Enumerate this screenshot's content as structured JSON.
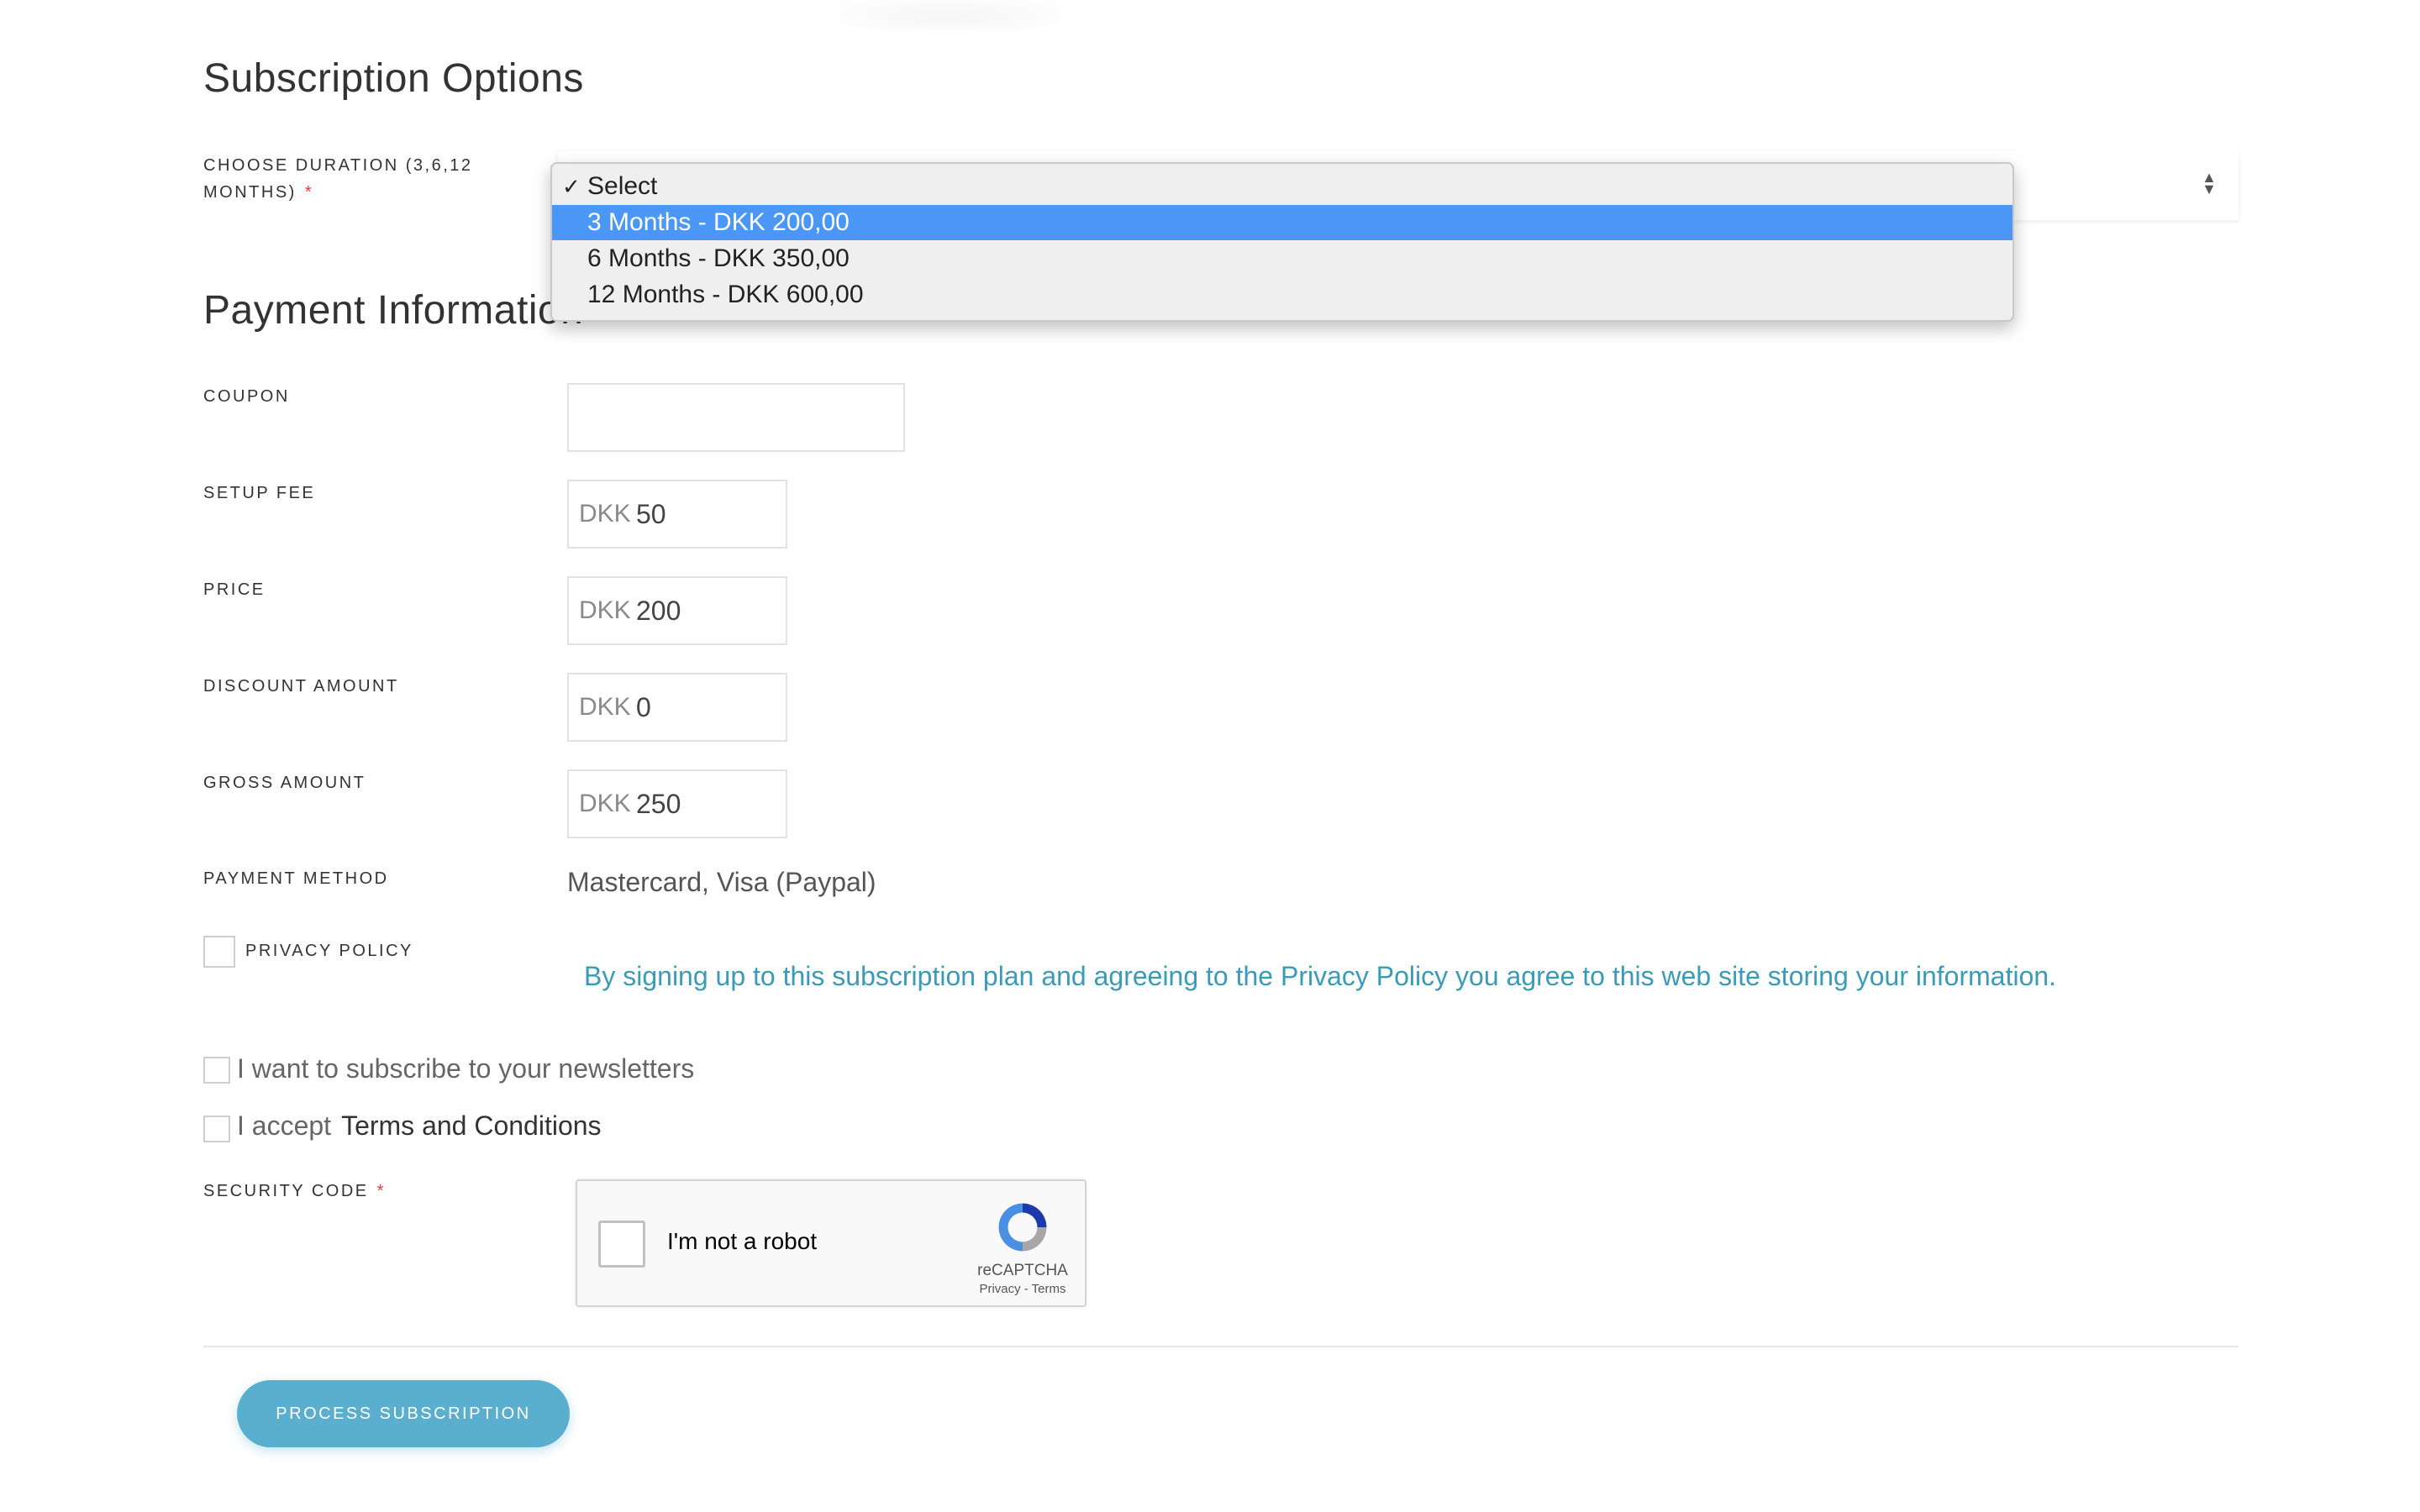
{
  "subscription": {
    "title": "Subscription Options",
    "duration_label": "CHOOSE DURATION (3,6,12 MONTHS)",
    "required_mark": "*",
    "select": {
      "current": "Select",
      "check_glyph": "✓",
      "options": [
        "Select",
        "3 Months - DKK 200,00",
        "6 Months - DKK 350,00",
        "12 Months - DKK 600,00"
      ],
      "highlighted_index": 1
    }
  },
  "payment": {
    "title": "Payment Information",
    "coupon_label": "COUPON",
    "coupon_value": "",
    "currency": "DKK",
    "setup_fee_label": "SETUP FEE",
    "setup_fee_value": "50",
    "price_label": "PRICE",
    "price_value": "200",
    "discount_label": "DISCOUNT AMOUNT",
    "discount_value": "0",
    "gross_label": "GROSS AMOUNT",
    "gross_value": "250",
    "method_label": "PAYMENT METHOD",
    "method_value": "Mastercard, Visa (Paypal)",
    "privacy_label": "PRIVACY POLICY",
    "privacy_text": "By signing up to this subscription plan and agreeing to the Privacy Policy you agree to this web site storing your information.",
    "newsletter_text": "I want to subscribe to your newsletters",
    "accept_text": "I accept",
    "terms_text": "Terms and Conditions",
    "security_label": "SECURITY CODE"
  },
  "recaptcha": {
    "label": "I'm not a robot",
    "brand": "reCAPTCHA",
    "links": "Privacy - Terms"
  },
  "submit_label": "PROCESS SUBSCRIPTION",
  "colors": {
    "accent": "#5aafcf",
    "link_text": "#3a9bb8",
    "dropdown_highlight": "#4a97f7",
    "required": "#e53935"
  }
}
